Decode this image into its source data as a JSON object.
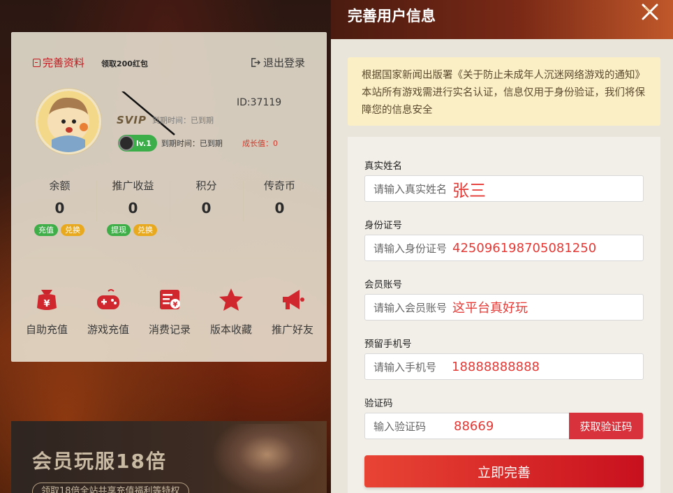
{
  "user_card": {
    "complete_link": "完善资料",
    "redpack_tip": "领取200红包",
    "logout": "退出登录",
    "user_id": "ID:37119",
    "svip_tag": "SVIP",
    "svip_expire": "到期时间：已到期",
    "level_badge": "lv.1",
    "level_expire": "到期时间：已到期",
    "growth": "成长值：0",
    "stats": [
      {
        "label": "余额",
        "value": "0"
      },
      {
        "label": "推广收益",
        "value": "0"
      },
      {
        "label": "积分",
        "value": "0"
      },
      {
        "label": "传奇币",
        "value": "0"
      }
    ],
    "balance_btns": [
      "充值",
      "兑换"
    ],
    "promo_btns": [
      "提现",
      "兑换"
    ],
    "menu": [
      {
        "label": "自助充值",
        "icon": "wallet-icon"
      },
      {
        "label": "游戏充值",
        "icon": "gamepad-icon"
      },
      {
        "label": "消费记录",
        "icon": "record-icon"
      },
      {
        "label": "版本收藏",
        "icon": "star-icon"
      },
      {
        "label": "推广好友",
        "icon": "megaphone-icon"
      }
    ]
  },
  "promo_banner": {
    "title": "会员玩服18倍",
    "subtitle": "领取18倍全站共享充值福利等特权"
  },
  "panel": {
    "title": "完善用户信息",
    "notice": "根据国家新闻出版署《关于防止未成年人沉迷网络游戏的通知》本站所有游戏需进行实名认证，信息仅用于身份验证，我们将保障您的信息安全",
    "fields": {
      "name": {
        "label": "真实姓名",
        "placeholder": "请输入真实姓名",
        "value": "张三"
      },
      "idcard": {
        "label": "身份证号",
        "placeholder": "请输入身份证号",
        "value": "425096198705081250"
      },
      "account": {
        "label": "会员账号",
        "placeholder": "请输入会员账号",
        "value": "这平台真好玩"
      },
      "phone": {
        "label": "预留手机号",
        "placeholder": "请输入手机号",
        "value": "18888888888"
      },
      "code": {
        "label": "验证码",
        "placeholder": "输入验证码",
        "value": "88669",
        "button": "获取验证码"
      }
    },
    "submit": "立即完善"
  },
  "colors": {
    "accent_red": "#d8333c",
    "notice_bg": "#fbefc6",
    "green": "#3fae49",
    "yellow": "#e9a91f"
  }
}
